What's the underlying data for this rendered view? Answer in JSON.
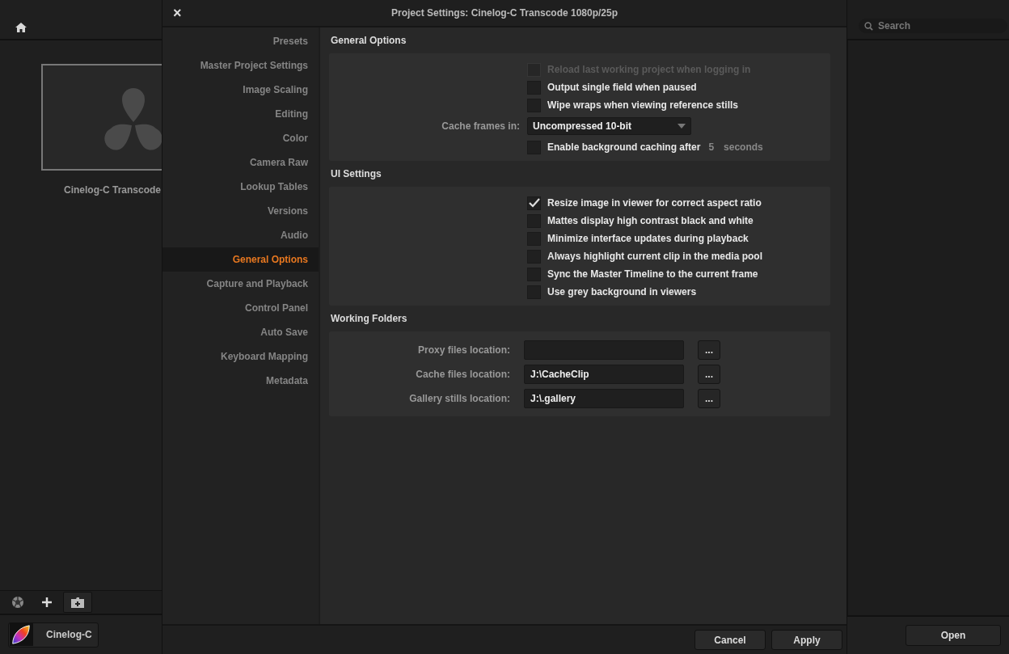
{
  "background_app": {
    "project_thumbnail": {
      "label": "Cinelog-C Transcode"
    },
    "search": {
      "placeholder": "Search"
    },
    "project_button": "Cinelog-C",
    "open_button": "Open"
  },
  "dialog": {
    "title": "Project Settings:  Cinelog-C Transcode 1080p/25p",
    "close": "×",
    "sidebar": [
      {
        "label": "Presets",
        "selected": false
      },
      {
        "label": "Master Project Settings",
        "selected": false
      },
      {
        "label": "Image Scaling",
        "selected": false
      },
      {
        "label": "Editing",
        "selected": false
      },
      {
        "label": "Color",
        "selected": false
      },
      {
        "label": "Camera Raw",
        "selected": false
      },
      {
        "label": "Lookup Tables",
        "selected": false
      },
      {
        "label": "Versions",
        "selected": false
      },
      {
        "label": "Audio",
        "selected": false
      },
      {
        "label": "General Options",
        "selected": true
      },
      {
        "label": "Capture and Playback",
        "selected": false
      },
      {
        "label": "Control Panel",
        "selected": false
      },
      {
        "label": "Auto Save",
        "selected": false
      },
      {
        "label": "Keyboard Mapping",
        "selected": false
      },
      {
        "label": "Metadata",
        "selected": false
      }
    ],
    "general_options": {
      "title": "General Options",
      "rows": [
        {
          "kind": "checkbox",
          "label": "Reload last working project when logging in",
          "checked": false,
          "disabled": true
        },
        {
          "kind": "checkbox",
          "label": "Output single field when paused",
          "checked": false,
          "disabled": false
        },
        {
          "kind": "checkbox",
          "label": "Wipe wraps when viewing reference stills",
          "checked": false,
          "disabled": false
        },
        {
          "kind": "dropdown",
          "label": "Cache frames in:",
          "value": "Uncompressed 10-bit"
        },
        {
          "kind": "timed_checkbox",
          "label": "Enable background caching after",
          "checked": false,
          "disabled": false,
          "value": "5",
          "unit": "seconds"
        }
      ]
    },
    "ui_settings": {
      "title": "UI Settings",
      "rows": [
        {
          "kind": "checkbox",
          "label": "Resize image in viewer for correct aspect ratio",
          "checked": true,
          "disabled": false
        },
        {
          "kind": "checkbox",
          "label": "Mattes display high contrast black and white",
          "checked": false,
          "disabled": false
        },
        {
          "kind": "checkbox",
          "label": "Minimize interface updates during playback",
          "checked": false,
          "disabled": false
        },
        {
          "kind": "checkbox",
          "label": "Always highlight current clip in the media pool",
          "checked": false,
          "disabled": false
        },
        {
          "kind": "checkbox",
          "label": "Sync the Master Timeline to the current frame",
          "checked": false,
          "disabled": false
        },
        {
          "kind": "checkbox",
          "label": "Use grey background in viewers",
          "checked": false,
          "disabled": false
        }
      ]
    },
    "working_folders": {
      "title": "Working Folders",
      "rows": [
        {
          "label": "Proxy files location:",
          "browse": "..."
        },
        {
          "label": "Cache files location:",
          "value": "J:\\CacheClip",
          "browse": "..."
        },
        {
          "label": "Gallery stills location:",
          "value": "J:\\.gallery",
          "browse": "..."
        }
      ]
    },
    "buttons": [
      "Cancel",
      "Apply"
    ]
  }
}
